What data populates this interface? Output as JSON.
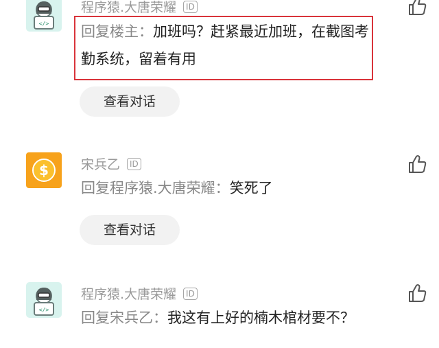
{
  "comments": [
    {
      "user": "程序猿.大唐荣耀",
      "id_badge": "ID",
      "reply_prefix": "回复楼主：",
      "reply_text": "加班吗？赶紧最近加班，在截图考勤系统，留着有用",
      "view_button": "查看对话",
      "avatar": "coder-avatar-icon"
    },
    {
      "user": "宋兵乙",
      "id_badge": "ID",
      "reply_prefix": "回复程序猿.大唐荣耀：",
      "reply_text": "笑死了",
      "view_button": "查看对话",
      "avatar": "dollar-coin-icon"
    },
    {
      "user": "程序猿.大唐荣耀",
      "id_badge": "ID",
      "reply_prefix": "回复宋兵乙：",
      "reply_text": "我这有上好的楠木棺材要不？",
      "avatar": "coder-avatar-icon"
    }
  ],
  "colors": {
    "highlight_border": "#d9333a",
    "coin": "#f7a21b",
    "coder_bg": "#d8f3ee"
  }
}
